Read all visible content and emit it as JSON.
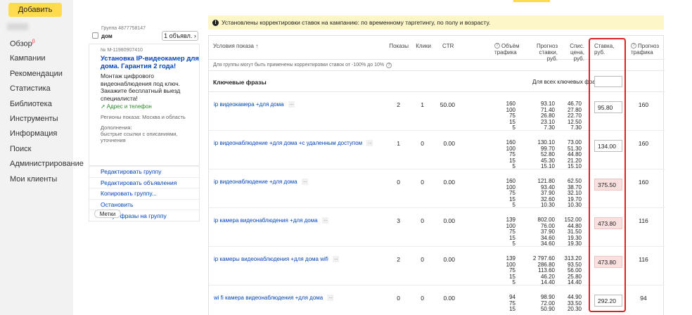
{
  "sidebar": {
    "add_label": "Добавить",
    "items": [
      {
        "label": "Обзор",
        "badge": "β"
      },
      {
        "label": "Кампании"
      },
      {
        "label": "Рекомендации"
      },
      {
        "label": "Статистика"
      },
      {
        "label": "Библиотека"
      },
      {
        "label": "Инструменты"
      },
      {
        "label": "Информация"
      },
      {
        "label": "Поиск"
      },
      {
        "label": "Администрирование"
      },
      {
        "label": "Мои клиенты"
      }
    ]
  },
  "group": {
    "number": "Группа 4877758147",
    "name": "дом",
    "ads_button": "1 объявл.",
    "ad_id": "№ М-11980907410",
    "ad_title": "Установка IP-видеокамер для дома. Гарантия 2 года!",
    "ad_body": "Монтаж цифрового видеонаблюдения под ключ. Закажите бесплатный выезд специалиста!",
    "ad_address": "Адрес и телефон",
    "regions": "Регионы показа: Москва и область",
    "extras_title": "Дополнения:",
    "extras_text": "быстрые ссылки с описаниями, уточнения",
    "actions": [
      "Редактировать группу",
      "Редактировать объявления",
      "Копировать группу...",
      "Остановить",
      "Минус-фразы на группу"
    ],
    "tags": "Метки"
  },
  "notice": "Установлены корректировки ставок на кампанию: по временному таргетингу, по полу и возрасту.",
  "table": {
    "headers": {
      "conditions": "Условия показа",
      "shows": "Показы",
      "clicks": "Клики",
      "ctr": "CTR",
      "volume": "Объём трафика",
      "forecast": "Прогноз ставки, руб.",
      "price": "Спис. цена, руб.",
      "bid": "Ставка, руб.",
      "traffic_forecast": "Прогноз трафика"
    },
    "hint": "Для группы могут быть применены корректировки ставок от -100% до 10%",
    "keywords_title": "Ключевые фразы",
    "all_keywords": "Для всех ключевых фраз",
    "more": "···",
    "rows": [
      {
        "kw": "ip видеокамера +для дома",
        "shows": "2",
        "clicks": "1",
        "ctr": "50.00",
        "vol": [
          "160",
          "100",
          "75",
          "15",
          "5"
        ],
        "fc": [
          "93.10",
          "71.40",
          "26.80",
          "23.10",
          "7.30"
        ],
        "pr": [
          "46.70",
          "27.80",
          "22.70",
          "12.50",
          "7.30"
        ],
        "bid": "95.80",
        "red": false,
        "tf": "160"
      },
      {
        "kw": "ip видеонаблюдение +для дома +с удаленным доступом",
        "shows": "1",
        "clicks": "0",
        "ctr": "0.00",
        "vol": [
          "160",
          "100",
          "75",
          "15",
          "5"
        ],
        "fc": [
          "130.10",
          "99.70",
          "52.80",
          "45.30",
          "15.10"
        ],
        "pr": [
          "73.00",
          "51.30",
          "44.80",
          "21.20",
          "15.10"
        ],
        "bid": "134.00",
        "red": false,
        "tf": "160"
      },
      {
        "kw": "ip видеонаблюдение +для дома",
        "shows": "0",
        "clicks": "0",
        "ctr": "0.00",
        "vol": [
          "160",
          "100",
          "75",
          "15",
          "5"
        ],
        "fc": [
          "121.80",
          "93.40",
          "37.90",
          "32.60",
          "10.30"
        ],
        "pr": [
          "62.50",
          "38.70",
          "32.10",
          "19.70",
          "10.30"
        ],
        "bid": "375.50",
        "red": true,
        "tf": "160"
      },
      {
        "kw": "ip камера видеонаблюдения +для дома",
        "shows": "3",
        "clicks": "0",
        "ctr": "0.00",
        "vol": [
          "139",
          "100",
          "75",
          "15",
          "5"
        ],
        "fc": [
          "802.00",
          "76.00",
          "37.90",
          "34.60",
          "34.60"
        ],
        "pr": [
          "152.00",
          "44.80",
          "31.50",
          "19.30",
          "19.30"
        ],
        "bid": "473.80",
        "red": true,
        "tf": "116"
      },
      {
        "kw": "ip камеры видеонаблюдения +для дома wifi",
        "shows": "2",
        "clicks": "0",
        "ctr": "0.00",
        "vol": [
          "139",
          "100",
          "75",
          "15",
          "5"
        ],
        "fc": [
          "2 797.60",
          "286.80",
          "113.60",
          "46.20",
          "14.40"
        ],
        "pr": [
          "313.20",
          "93.50",
          "56.00",
          "25.80",
          "14.40"
        ],
        "bid": "473.80",
        "red": true,
        "tf": "116"
      },
      {
        "kw": "wi fi камера видеонаблюдения +для дома",
        "shows": "0",
        "clicks": "0",
        "ctr": "0.00",
        "vol": [
          "94",
          "75",
          "15"
        ],
        "fc": [
          "98.90",
          "72.00",
          "50.90"
        ],
        "pr": [
          "44.90",
          "33.50",
          "20.30"
        ],
        "bid": "292.20",
        "red": false,
        "tf": "94"
      }
    ]
  },
  "colors": {
    "accent": "#ffdb4d",
    "link": "#0044bb",
    "highlight": "#e02020",
    "notice_bg": "#fdf6c8"
  }
}
